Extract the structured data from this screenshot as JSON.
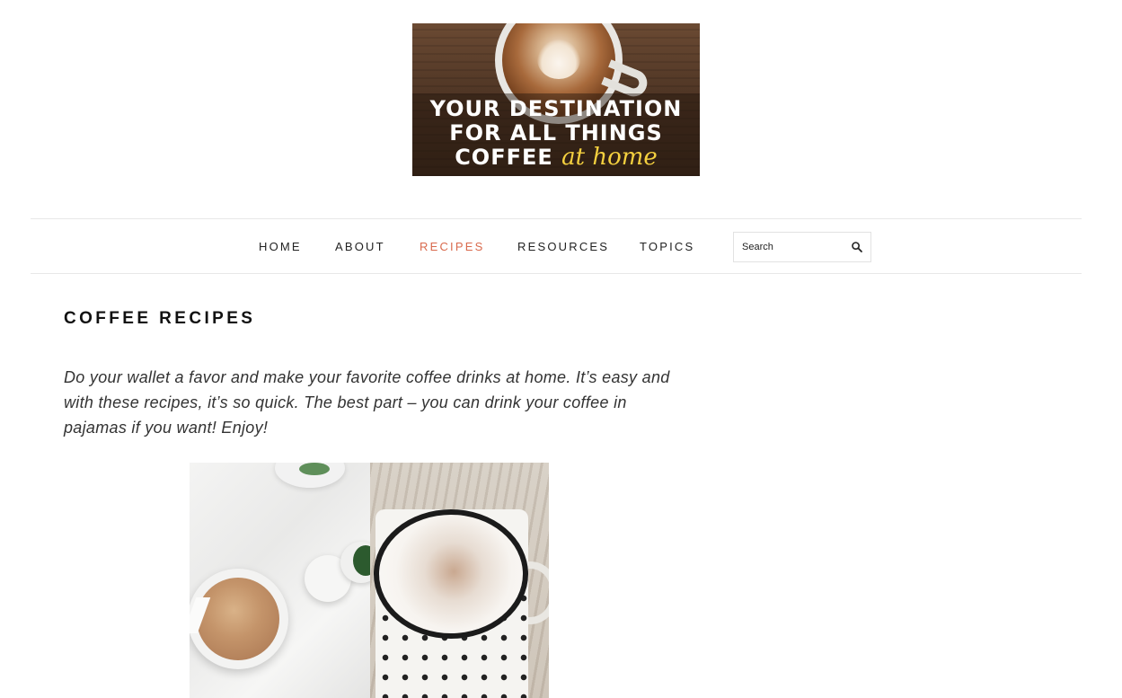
{
  "header": {
    "banner": {
      "line1": "YOUR DESTINATION",
      "line2": "FOR ALL THINGS",
      "line3_main": "COFFEE",
      "line3_script": "at home"
    }
  },
  "nav": {
    "items": [
      {
        "label": "HOME",
        "active": false
      },
      {
        "label": "ABOUT",
        "active": false
      },
      {
        "label": "RECIPES",
        "active": true
      },
      {
        "label": "RESOURCES",
        "active": false
      },
      {
        "label": "TOPICS",
        "active": false
      }
    ],
    "search": {
      "placeholder": "Search",
      "icon": "search-icon"
    },
    "active_color": "#d96a4d"
  },
  "main": {
    "title": "COFFEE RECIPES",
    "intro": "Do your wallet a favor and make your favorite coffee drinks at home. It’s easy and with these recipes, it’s so quick. The best part – you can drink your coffee in pajamas if you want! Enjoy!"
  }
}
